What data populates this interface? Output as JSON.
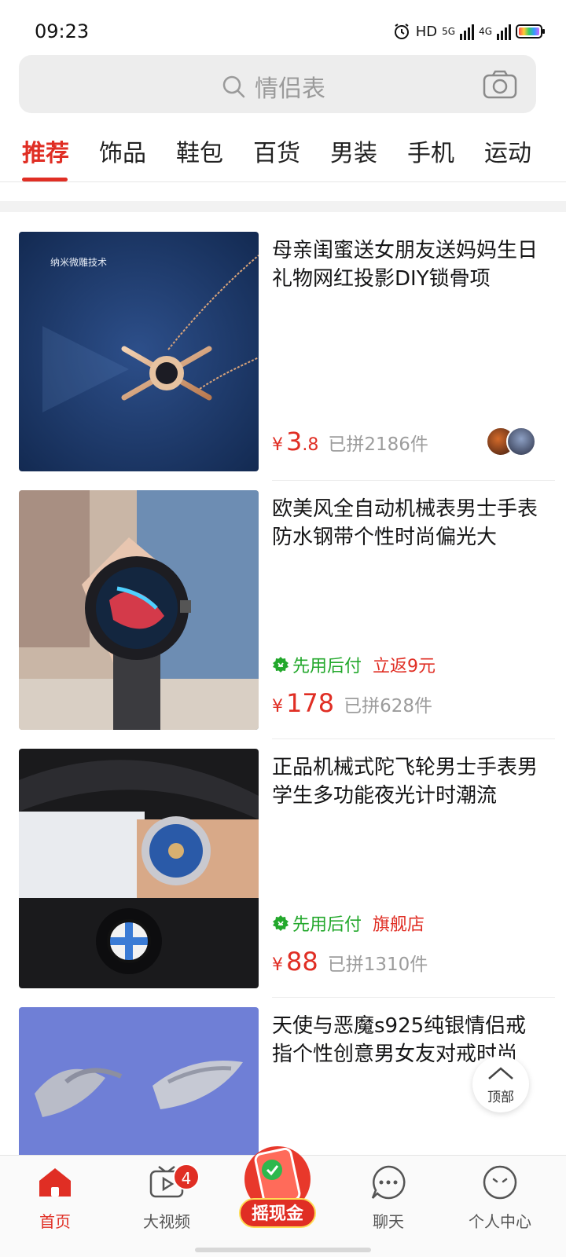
{
  "status_bar": {
    "time": "09:23",
    "hd": "HD",
    "net_5g": "5G",
    "net_4g": "4G"
  },
  "search": {
    "placeholder": "情侣表"
  },
  "tabs": [
    "推荐",
    "饰品",
    "鞋包",
    "百货",
    "男装",
    "手机",
    "运动"
  ],
  "products": [
    {
      "title": "母亲闺蜜送女朋友送妈妈生日礼物网红投影DIY锁骨项",
      "image_caption": "纳米微雕技术",
      "price_int": "3",
      "price_dec": ".8",
      "sold": "已拼2186件",
      "tags": []
    },
    {
      "title": "欧美风全自动机械表男士手表防水钢带个性时尚偏光大",
      "image_caption": "",
      "price_int": "178",
      "price_dec": "",
      "sold": "已拼628件",
      "tags": [
        "先用后付",
        "立返9元"
      ]
    },
    {
      "title": "正品机械式陀飞轮男士手表男学生多功能夜光计时潮流",
      "image_caption": "",
      "price_int": "88",
      "price_dec": "",
      "sold": "已拼1310件",
      "tags": [
        "先用后付",
        "旗舰店"
      ]
    },
    {
      "title": "天使与恶魔s925纯银情侣戒指个性创意男女友对戒时尚",
      "image_caption": "",
      "price_int": "",
      "price_dec": "",
      "sold": "",
      "tags": []
    }
  ],
  "currency_symbol": "¥",
  "back_to_top": "顶部",
  "bottom_nav": {
    "home": "首页",
    "video": "大视频",
    "video_badge": "4",
    "shake": "摇现金",
    "chat": "聊天",
    "profile": "个人中心"
  },
  "colors": {
    "accent": "#e02e24",
    "green": "#23a82c",
    "muted": "#9c9c9c"
  }
}
